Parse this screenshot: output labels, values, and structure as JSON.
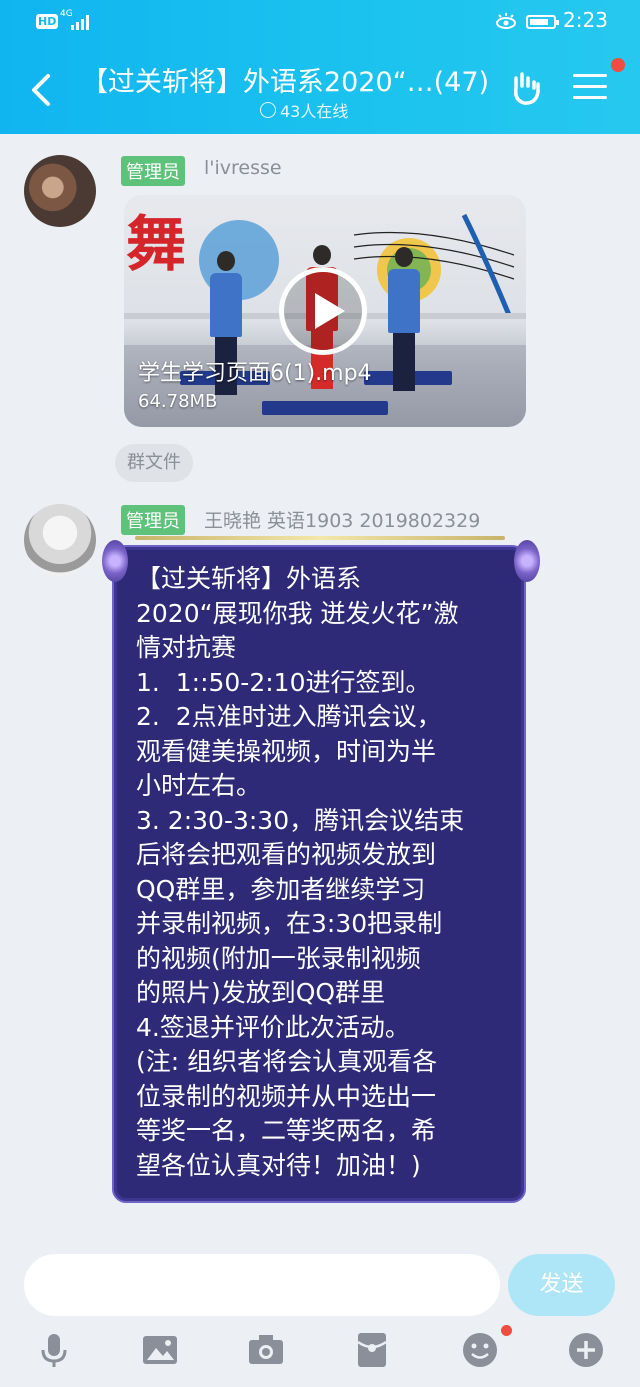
{
  "status_bar": {
    "hd": "HD",
    "network": "4G",
    "time": "2:23"
  },
  "header": {
    "title": "【过关斩将】外语系2020“…(47)",
    "online": "43人在线"
  },
  "messages": [
    {
      "role": "管理员",
      "sender": "l'ivresse",
      "file": {
        "name": "学生学习页面6(1).mp4",
        "size": "64.78MB"
      },
      "tag": "群文件"
    },
    {
      "role": "管理员",
      "sender": "王晓艳 英语1903 2019802329",
      "text": "【过关斩将】外语系\n2020“展现你我 迸发火花”激\n情对抗赛\n1.  1::50-2:10进行签到。\n2.  2点准时进入腾讯会议，\n观看健美操视频，时间为半\n小时左右。\n3. 2:30-3:30，腾讯会议结束\n后将会把观看的视频发放到\nQQ群里，参加者继续学习\n并录制视频，在3:30把录制\n的视频(附加一张录制视频\n的照片)发放到QQ群里\n4.签退并评价此次活动。\n(注: 组织者将会认真观看各\n位录制的视频并从中选出一\n等奖一名，二等奖两名，希\n望各位认真对待！加油！)"
    }
  ],
  "input": {
    "placeholder": "",
    "send_label": "发送"
  },
  "toolbar": [
    "mic-icon",
    "image-icon",
    "camera-icon",
    "red-packet-icon",
    "emoji-icon",
    "plus-icon"
  ],
  "colors": {
    "header": "#1cc3ee",
    "bubble": "#2e2a78",
    "admin_badge": "#5ec27a"
  }
}
